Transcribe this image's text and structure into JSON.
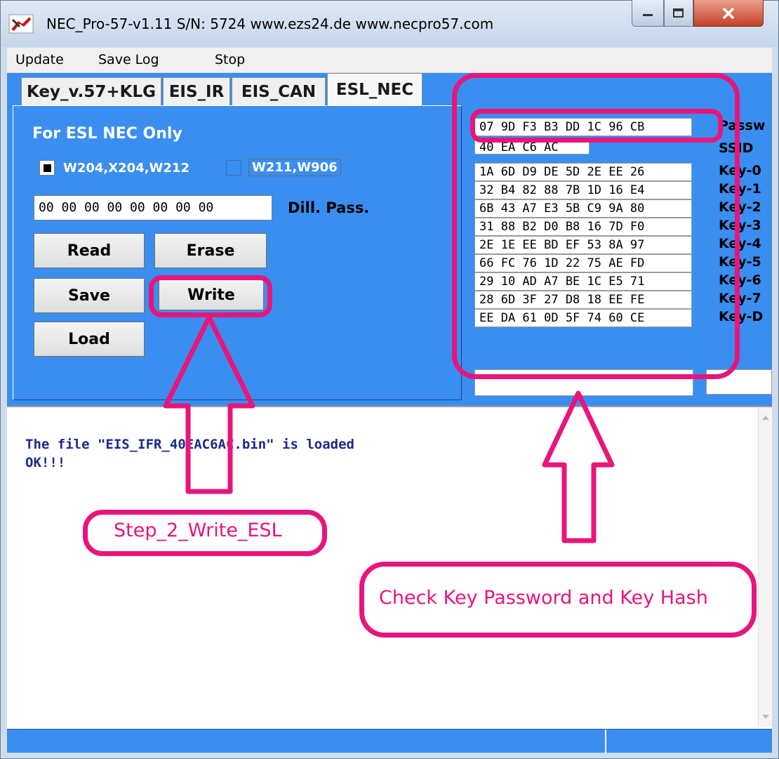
{
  "window": {
    "title": "NEC_Pro-57-v1.11   S/N: 5724   www.ezs24.de   www.necpro57.com"
  },
  "menu": {
    "items": [
      "Update",
      "Save Log",
      "Stop"
    ]
  },
  "tabs": [
    "Key_v.57+KLG",
    "EIS_IR",
    "EIS_CAN",
    "ESL_NEC"
  ],
  "active_tab": "ESL_NEC",
  "esl_panel": {
    "heading": "For ESL NEC Only",
    "option_1": {
      "label": "W204,X204,W212",
      "checked": true
    },
    "option_2": {
      "label": "W211,W906",
      "checked": false
    },
    "dill_pass_value": "00 00 00 00 00 00 00 00",
    "dill_pass_label": "Dill. Pass.",
    "buttons": {
      "read": "Read",
      "erase": "Erase",
      "save": "Save",
      "write": "Write",
      "load": "Load"
    }
  },
  "hex_panel": {
    "rows": [
      {
        "value": "07 9D F3 B3 DD 1C 96 CB",
        "label": "Passw"
      },
      {
        "value": "40 EA C6 AC",
        "label": "SSID"
      },
      {
        "value": "1A 6D D9 DE 5D 2E EE 26",
        "label": "Key-0"
      },
      {
        "value": "32 B4 82 88 7B 1D 16 E4",
        "label": "Key-1"
      },
      {
        "value": "6B 43 A7 E3 5B C9 9A 80",
        "label": "Key-2"
      },
      {
        "value": "31 88 B2 D0 B8 16 7D F0",
        "label": "Key-3"
      },
      {
        "value": "2E 1E EE BD EF 53 8A 97",
        "label": "Key-4"
      },
      {
        "value": "66 FC 76 1D 22 75 AE FD",
        "label": "Key-5"
      },
      {
        "value": "29 10 AD A7 BE 1C E5 71",
        "label": "Key-6"
      },
      {
        "value": "28 6D 3F 27 D8 18 EE FE",
        "label": "Key-7"
      },
      {
        "value": "EE DA 61 0D 5F 74 60 CE",
        "label": "Key-D"
      }
    ]
  },
  "log": {
    "lines": [
      "The file \"EIS_IFR_40EAC6AC.bin\" is loaded",
      "OK!!!"
    ]
  },
  "annotations": {
    "step2": "Step_2_Write_ESL",
    "check": "Check Key Password and Key Hash",
    "color": "#e8157a"
  },
  "colors": {
    "panel_blue": "#3a8ef0",
    "log_text": "#1b2a8c"
  }
}
